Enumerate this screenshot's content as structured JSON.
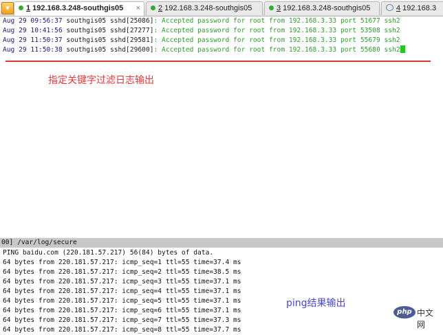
{
  "tabs": [
    {
      "number": "1",
      "label": "192.168.3.248-southgis05",
      "active": true,
      "icon": "green-dot-icon"
    },
    {
      "number": "2",
      "label": "192.168.3.248-southgis05",
      "active": false,
      "icon": "green-dot-icon"
    },
    {
      "number": "3",
      "label": "192.168.3.248-southgis05",
      "active": false,
      "icon": "green-dot-icon"
    },
    {
      "number": "4",
      "label": "192.168.3",
      "active": false,
      "icon": "chat-bubble-icon"
    }
  ],
  "tab_close": "×",
  "menu_icon": "▾",
  "log_lines": [
    {
      "date": "Aug 29 09:56:37",
      "host": "southgis05 sshd[25086]",
      "message": ": Accepted password for root from 192.168.3.33 port 51677 ssh2"
    },
    {
      "date": "Aug 29 10:41:56",
      "host": "southgis05 sshd[27277]",
      "message": ": Accepted password for root from 192.168.3.33 port 53508 ssh2"
    },
    {
      "date": "Aug 29 11:50:37",
      "host": "southgis05 sshd[29581]",
      "message": ": Accepted password for root from 192.168.3.33 port 55679 ssh2"
    },
    {
      "date": "Aug 29 11:50:38",
      "host": "southgis05 sshd[29600]",
      "message": ": Accepted password for root from 192.168.3.33 port 55680 ssh2"
    }
  ],
  "annotation_top": "指定关键字过滤日志输出",
  "status_bar": "00] /var/log/secure",
  "ping_header": "PING baidu.com (220.181.57.217) 56(84) bytes of data.",
  "ping_lines": [
    "64 bytes from 220.181.57.217: icmp_seq=1 ttl=55 time=37.4 ms",
    "64 bytes from 220.181.57.217: icmp_seq=2 ttl=55 time=38.5 ms",
    "64 bytes from 220.181.57.217: icmp_seq=3 ttl=55 time=37.1 ms",
    "64 bytes from 220.181.57.217: icmp_seq=4 ttl=55 time=37.1 ms",
    "64 bytes from 220.181.57.217: icmp_seq=5 ttl=55 time=37.1 ms",
    "64 bytes from 220.181.57.217: icmp_seq=6 ttl=55 time=37.1 ms",
    "64 bytes from 220.181.57.217: icmp_seq=7 ttl=55 time=37.3 ms",
    "64 bytes from 220.181.57.217: icmp_seq=8 ttl=55 time=37.7 ms"
  ],
  "annotation_bottom": "ping结果输出",
  "watermark": {
    "logo": "php",
    "text": "中文网"
  },
  "colors": {
    "accent_red": "#e03a3a",
    "accent_blue": "#4545e0",
    "log_green": "#2e9e2e",
    "cursor_green": "#20c820"
  }
}
